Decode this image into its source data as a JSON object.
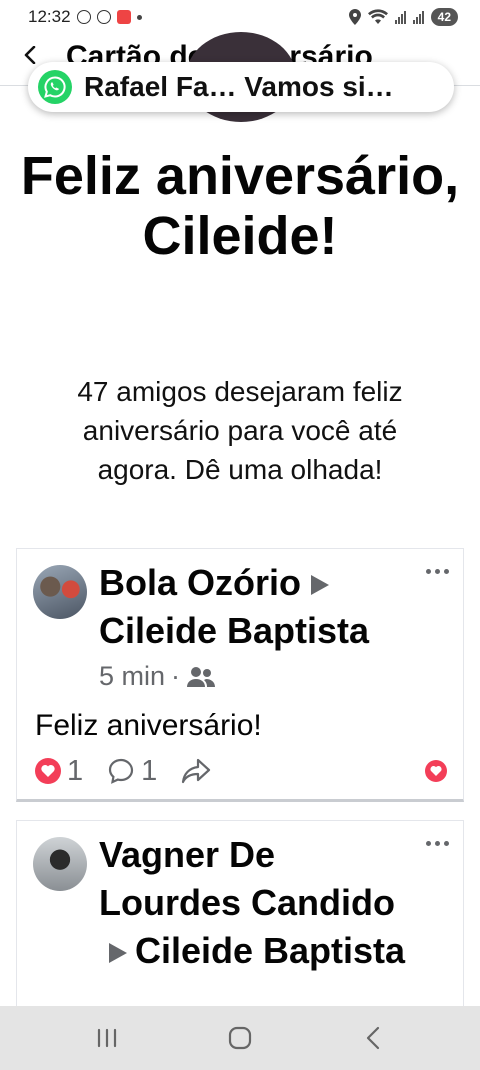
{
  "status_bar": {
    "time": "12:32",
    "battery": "42"
  },
  "header": {
    "title": "Cartão de aniversário"
  },
  "whatsapp_bubble": {
    "text": "Rafael Fa… Vamos si…"
  },
  "birthday": {
    "title": "Feliz aniversário, Cileide!",
    "subtitle": "47 amigos desejaram feliz aniversário para você até agora. Dê uma olhada!"
  },
  "posts": [
    {
      "author": "Bola Ozório",
      "recipient": "Cileide Baptista",
      "time": "5 min",
      "text": "Feliz aniversário!",
      "reactions": "1",
      "comments": "1"
    },
    {
      "author": "Vagner De Lourdes Candido",
      "recipient": "Cileide Baptista"
    }
  ],
  "colors": {
    "accent": "#f33e58",
    "whatsapp": "#25d366",
    "meta": "#65676b"
  }
}
